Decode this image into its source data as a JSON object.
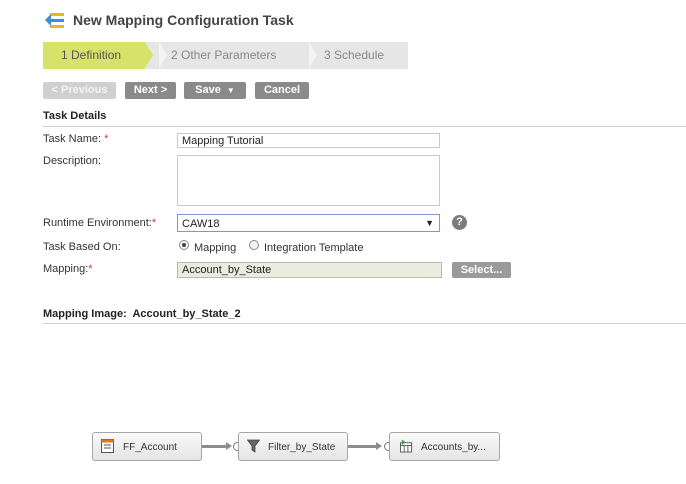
{
  "header": {
    "title": "New Mapping Configuration Task",
    "icon": "mapping-task-icon"
  },
  "wizard": {
    "steps": [
      {
        "label": "1  Definition",
        "active": true
      },
      {
        "label": "2  Other Parameters",
        "active": false
      },
      {
        "label": "3  Schedule",
        "active": false
      }
    ]
  },
  "toolbar": {
    "previous_label": "< Previous",
    "next_label": "Next >",
    "save_label": "Save",
    "cancel_label": "Cancel"
  },
  "task_details": {
    "heading": "Task Details",
    "task_name_label": "Task Name:",
    "task_name_value": "Mapping Tutorial",
    "description_label": "Description:",
    "description_value": "",
    "runtime_label": "Runtime Environment:",
    "runtime_value": "CAW18",
    "based_on_label": "Task Based On:",
    "option_mapping": "Mapping",
    "option_template": "Integration Template",
    "selected_option": "Mapping",
    "mapping_label": "Mapping:",
    "mapping_value": "Account_by_State",
    "select_button": "Select...",
    "required_mark": "*"
  },
  "mapping_image": {
    "heading_label": "Mapping Image:",
    "heading_value": "Account_by_State_2",
    "nodes": [
      {
        "label": "FF_Account",
        "icon": "flat-file-source-icon"
      },
      {
        "label": "Filter_by_State",
        "icon": "filter-icon"
      },
      {
        "label": "Accounts_by...",
        "icon": "target-table-icon"
      }
    ]
  },
  "colors": {
    "active_step": "#d6e36b",
    "button": "#8a8a8a",
    "required": "#dd3333"
  }
}
